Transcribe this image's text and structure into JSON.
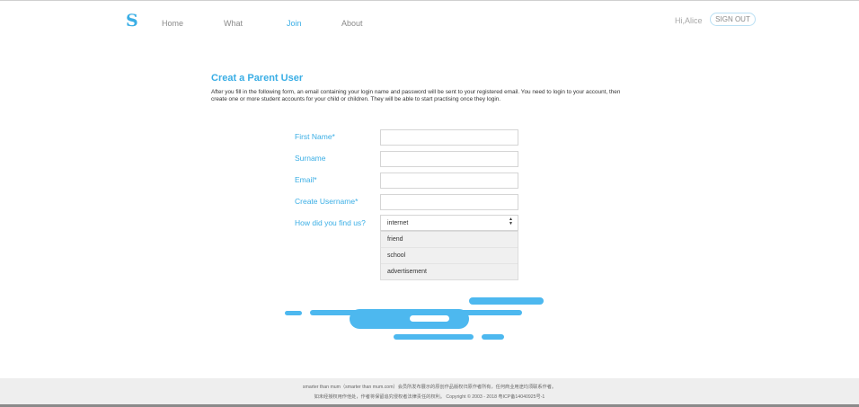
{
  "header": {
    "logo": "S",
    "nav": [
      "Home",
      "What",
      "Join",
      "About"
    ],
    "active_nav": "Join",
    "greeting": "Hi,Alice",
    "sign_out_label": "SIGN OUT"
  },
  "main": {
    "title": "Creat a Parent User",
    "intro": "After you fill in the following form, an email containing your login name and password will be sent to your registered email. You need to login to your account, then create one or more student accounts for your child or children. They will be able to start practising once they login."
  },
  "form": {
    "first_name_label": "First Name*",
    "first_name_value": "",
    "surname_label": "Surname",
    "surname_value": "",
    "email_label": "Email*",
    "email_value": "",
    "username_label": "Create Username*",
    "username_value": "",
    "find_us_label": "How did you find us?",
    "find_us_selected": "internet",
    "find_us_options": [
      "friend",
      "school",
      "advertisement"
    ]
  },
  "footer": {
    "line1": "smarter than mum（smarter than mum.com）会员所发布展示的原创作品版权归原作者所有，任何商业用途均须联系作者。",
    "line2": "如未经授权用作他处，作者将保留追究侵权者法律责任的权利。 Copyright © 2003 - 2018    粤ICP备14040925号-1"
  },
  "colors": {
    "accent": "#3aaee5",
    "cloud": "#4db8ef"
  }
}
